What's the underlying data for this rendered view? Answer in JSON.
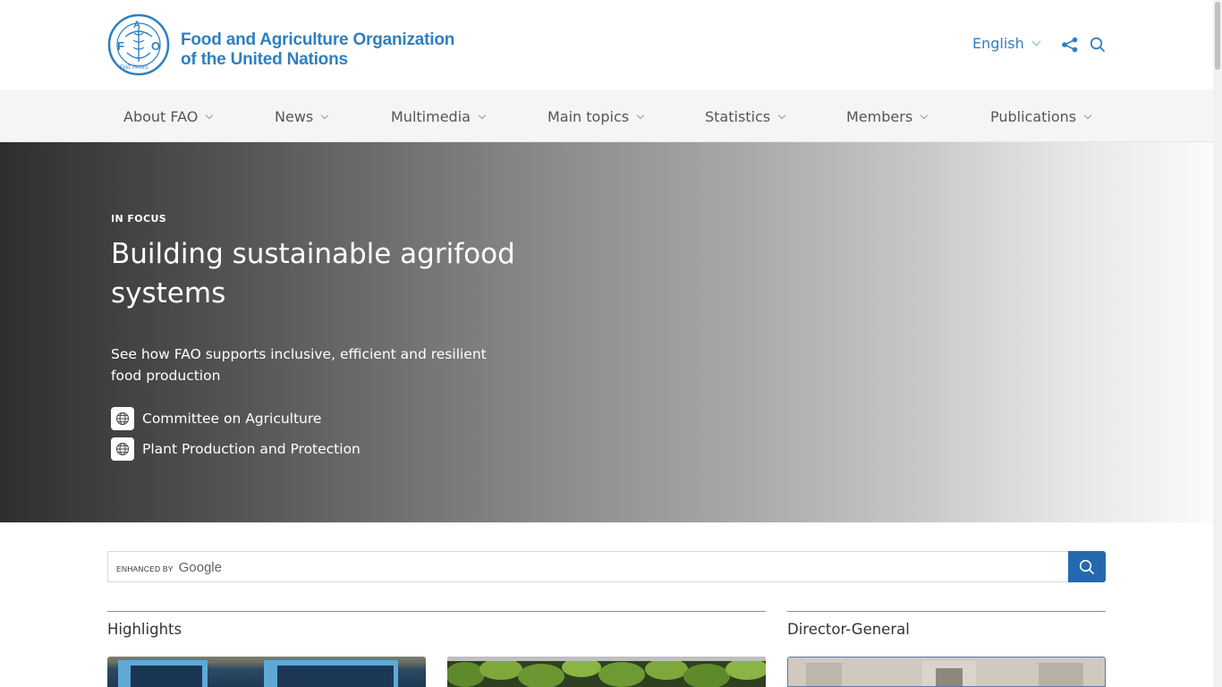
{
  "header": {
    "org_line1": "Food and Agriculture Organization",
    "org_line2": "of the United Nations",
    "logo_text": "FAO",
    "logo_motto": "FIAT PANIS",
    "language": "English"
  },
  "nav": {
    "items": [
      {
        "label": "About FAO"
      },
      {
        "label": "News"
      },
      {
        "label": "Multimedia"
      },
      {
        "label": "Main topics"
      },
      {
        "label": "Statistics"
      },
      {
        "label": "Members"
      },
      {
        "label": "Publications"
      }
    ]
  },
  "hero": {
    "eyebrow": "IN FOCUS",
    "title": "Building sustainable agrifood systems",
    "description": "See how FAO supports inclusive, efficient and resilient food production",
    "links": [
      {
        "label": "Committee on Agriculture",
        "icon": "globe-icon"
      },
      {
        "label": "Plant Production and Protection",
        "icon": "globe-icon"
      }
    ]
  },
  "search": {
    "enhanced_by": "ENHANCED BY",
    "provider": "Google"
  },
  "sections": {
    "highlights": "Highlights",
    "director_general": "Director-General"
  },
  "colors": {
    "brand_blue": "#2f7fc1",
    "search_button": "#2468b0",
    "nav_bg": "#f4f5f7"
  }
}
